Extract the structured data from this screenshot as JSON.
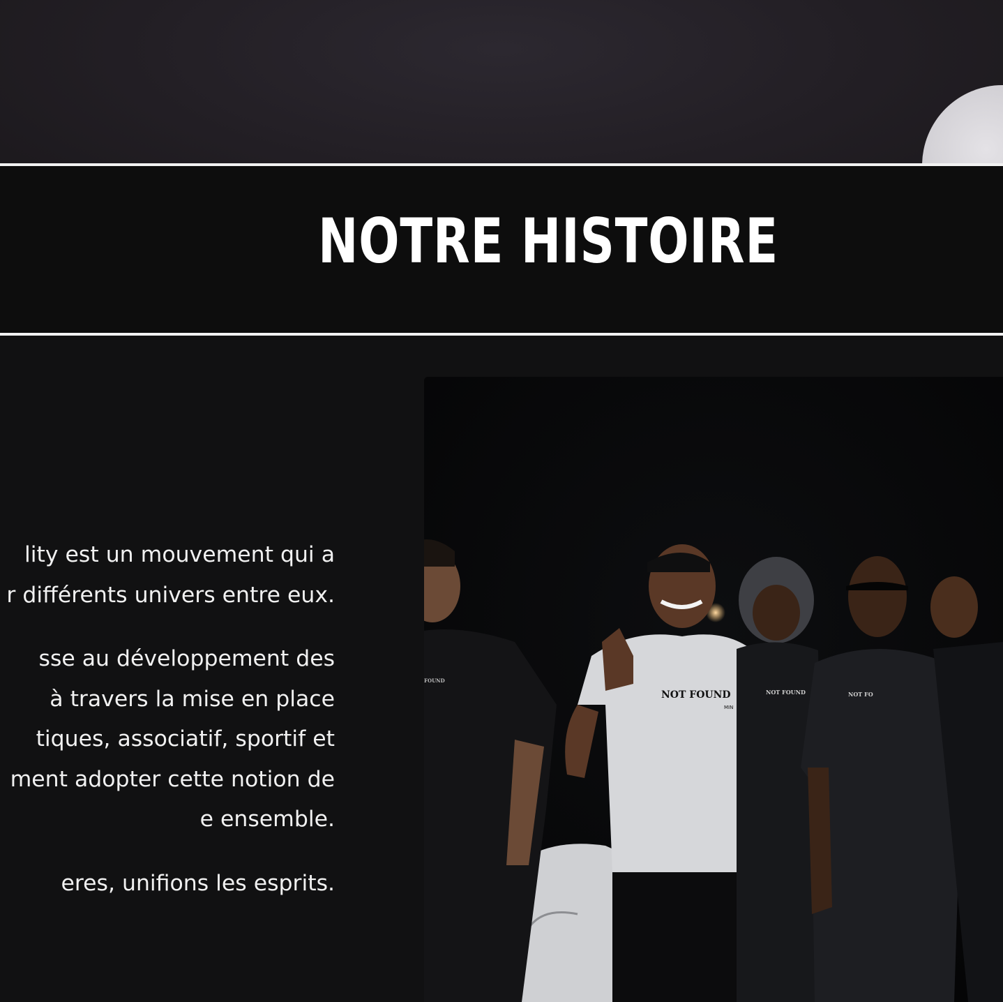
{
  "hero": {
    "image_alt": "blurred dark photo header"
  },
  "section": {
    "title": "NOTRE HISTOIRE"
  },
  "story": {
    "paragraphs": [
      "lity est un mouvement qui a\nr différents univers entre eux.",
      "sse au développement des\nà travers la mise en place\ntiques, associatif, sportif et\nment adopter cette notion de\ne ensemble.",
      "eres, unifions les esprits."
    ]
  },
  "photo": {
    "alt": "group of young men at night wearing NOT FOUND t-shirts",
    "shirt_prints": [
      "FOUND",
      "NOT FOUND",
      "NOT FOUND",
      "NOT FO"
    ],
    "shirt_subprint": "MIN"
  },
  "colors": {
    "background": "#111112",
    "band": "#0d0d0d",
    "rule": "#f2f2f2",
    "text": "#f1f1f1"
  }
}
